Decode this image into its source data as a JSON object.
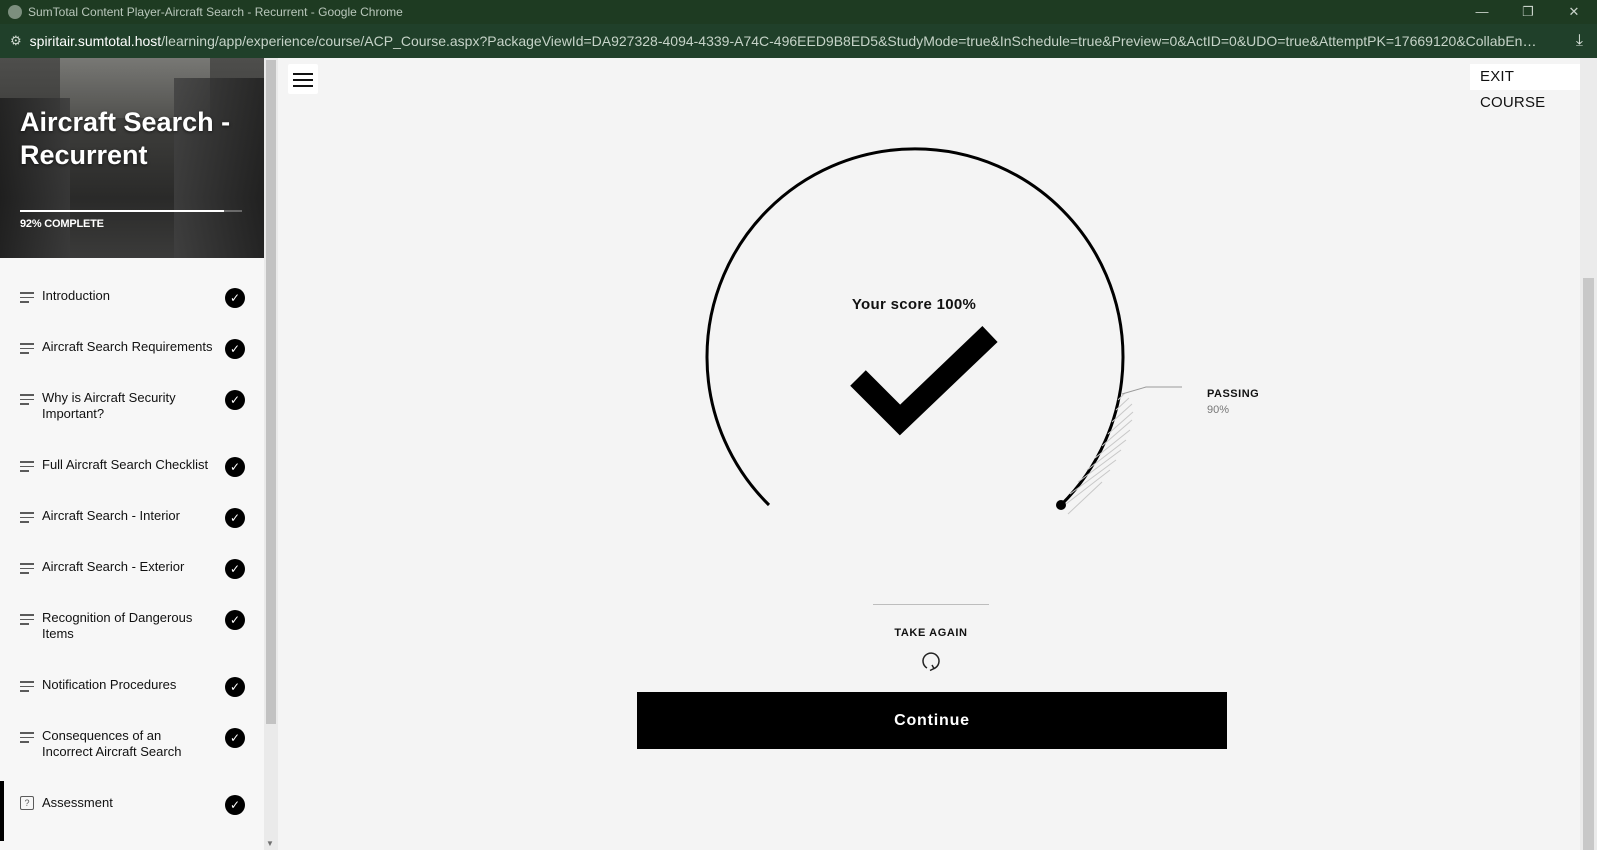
{
  "window": {
    "title": "SumTotal Content Player-Aircraft Search - Recurrent - Google Chrome",
    "minimize": "—",
    "restore": "❐",
    "close": "✕"
  },
  "address": {
    "host": "spiritair.sumtotal.host",
    "path": "/learning/app/experience/course/ACP_Course.aspx?PackageViewId=DA927328-4094-4339-A74C-496EED9B8ED5&StudyMode=true&InSchedule=true&Preview=0&ActID=0&UDO=true&AttemptPK=17669120&CollabEnab..."
  },
  "course": {
    "title": "Aircraft Search - Recurrent",
    "progress_label": "92% COMPLETE",
    "progress_fraction": 0.92
  },
  "nav": {
    "items": [
      {
        "label": "Introduction",
        "done": true
      },
      {
        "label": "Aircraft Search Requirements",
        "done": true
      },
      {
        "label": "Why is Aircraft Security Important?",
        "done": true
      },
      {
        "label": "Full Aircraft Search Checklist",
        "done": true
      },
      {
        "label": "Aircraft Search - Interior",
        "done": true
      },
      {
        "label": "Aircraft Search - Exterior",
        "done": true
      },
      {
        "label": "Recognition of Dangerous Items",
        "done": true
      },
      {
        "label": "Notification Procedures",
        "done": true
      },
      {
        "label": "Consequences of an Incorrect Aircraft Search",
        "done": true
      },
      {
        "label": "Assessment",
        "done": true
      }
    ]
  },
  "header": {
    "exit_label": "EXIT COURSE"
  },
  "result": {
    "score_text": "Your score 100%",
    "passing_label": "PASSING",
    "passing_value": "90%",
    "take_again_label": "TAKE AGAIN",
    "continue_label": "Continue"
  }
}
